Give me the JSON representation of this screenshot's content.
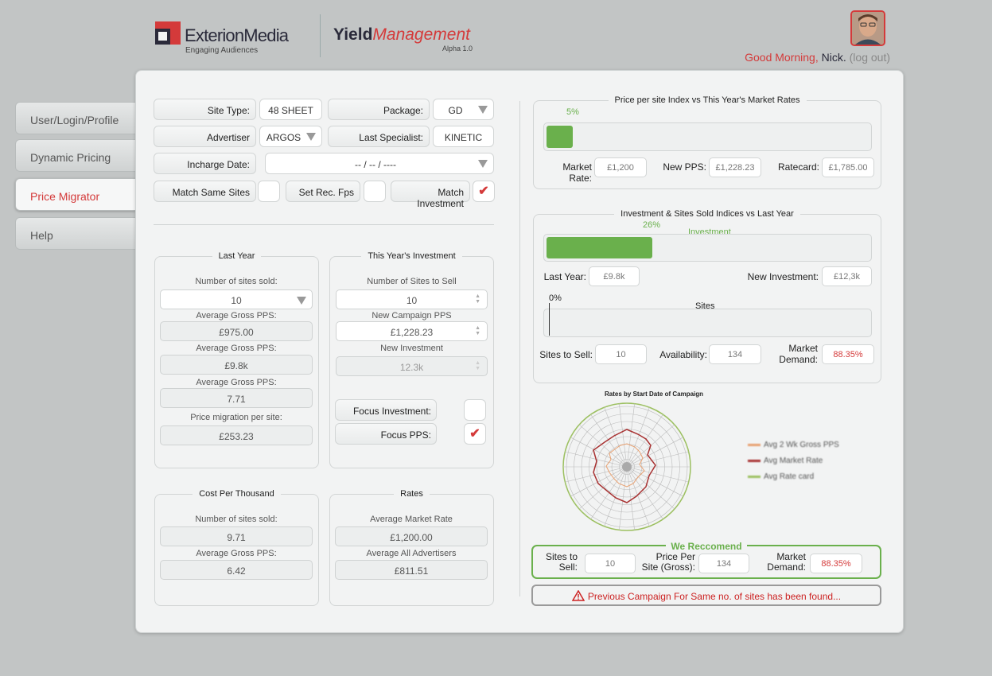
{
  "header": {
    "brand": "ExterionMedia",
    "tagline": "Engaging Audiences",
    "app_name_bold": "Yield",
    "app_name_italic": "Management",
    "version": "Alpha 1.0",
    "greeting": "Good Morning,",
    "user_name": "Nick.",
    "logout": "(log out)"
  },
  "nav": [
    {
      "label": "User/Login/Profile"
    },
    {
      "label": "Dynamic Pricing"
    },
    {
      "label": "Price Migrator"
    },
    {
      "label": "Help"
    }
  ],
  "form": {
    "site_type_label": "Site Type:",
    "site_type_value": "48 SHEET",
    "package_label": "Package:",
    "package_value": "GD",
    "advertiser_label": "Advertiser",
    "advertiser_value": "ARGOS",
    "last_specialist_label": "Last Specialist:",
    "last_specialist_value": "KINETIC",
    "incharge_date_label": "Incharge Date:",
    "incharge_date_value": "-- / -- / ----",
    "match_same_sites": "Match Same Sites",
    "set_rec_fps": "Set Rec. Fps",
    "match_investment": "Match Investment"
  },
  "last_year": {
    "title": "Last Year",
    "fields": [
      {
        "caption": "Number of sites sold:",
        "value": "10"
      },
      {
        "caption": "Average Gross PPS:",
        "value": "£975.00"
      },
      {
        "caption": "Average Gross PPS:",
        "value": "£9.8k"
      },
      {
        "caption": "Average Gross PPS:",
        "value": "7.71"
      },
      {
        "caption": "Price migration per site:",
        "value": "£253.23"
      }
    ]
  },
  "this_year": {
    "title": "This Year's Investment",
    "fields": [
      {
        "caption": "Number of Sites to Sell",
        "value": "10"
      },
      {
        "caption": "New Campaign PPS",
        "value": "£1,228.23"
      },
      {
        "caption": "New Investment",
        "value": "12.3k"
      }
    ],
    "focus_investment": "Focus Investment:",
    "focus_pps": "Focus PPS:"
  },
  "cpt": {
    "title": "Cost Per Thousand",
    "fields": [
      {
        "caption": "Number of sites sold:",
        "value": "9.71"
      },
      {
        "caption": "Average Gross PPS:",
        "value": "6.42"
      }
    ]
  },
  "rates": {
    "title": "Rates",
    "fields": [
      {
        "caption": "Average Market Rate",
        "value": "£1,200.00"
      },
      {
        "caption": "Average All Advertisers",
        "value": "£811.51"
      }
    ]
  },
  "price_index": {
    "title": "Price per site Index vs This Year's Market Rates",
    "percent_label": "5%",
    "fill_fraction": 0.05,
    "market_rate_label": "Market Rate:",
    "market_rate_value": "£1,200",
    "new_pps_label": "New PPS:",
    "new_pps_value": "£1,228.23",
    "ratecard_label": "Ratecard:",
    "ratecard_value": "£1,785.00"
  },
  "investment_index": {
    "title": "Investment & Sites Sold Indices vs Last Year",
    "investment_percent": "26%",
    "investment_fill_fraction": 0.26,
    "investment_label": "Investment",
    "last_year_label": "Last Year:",
    "last_year_value": "£9.8k",
    "new_investment_label": "New Investment:",
    "new_investment_value": "£12,3k",
    "sites_percent": "0%",
    "sites_fill_fraction": 0,
    "sites_label": "Sites",
    "sites_to_sell_label": "Sites to Sell:",
    "sites_to_sell_value": "10",
    "availability_label": "Availability:",
    "availability_value": "134",
    "market_demand_label_1": "Market",
    "market_demand_label_2": "Demand:",
    "market_demand_value": "88.35%"
  },
  "radar": {
    "title": "Rates by Start Date of Campaign",
    "legend": [
      {
        "name": "Avg 2 Wk Gross PPS",
        "color": "#e8a070"
      },
      {
        "name": "Avg Market Rate",
        "color": "#a83232"
      },
      {
        "name": "Avg Rate card",
        "color": "#9cc060"
      }
    ]
  },
  "recommend": {
    "title": "We Reccomend",
    "sites_label_1": "Sites to",
    "sites_label_2": "Sell:",
    "sites_value": "10",
    "pps_label_1": "Price Per",
    "pps_label_2": "Site (Gross):",
    "pps_value": "134",
    "demand_label_1": "Market",
    "demand_label_2": "Demand:",
    "demand_value": "88.35%"
  },
  "warning": {
    "text": "Previous Campaign For Same no.  of sites has been found..."
  }
}
